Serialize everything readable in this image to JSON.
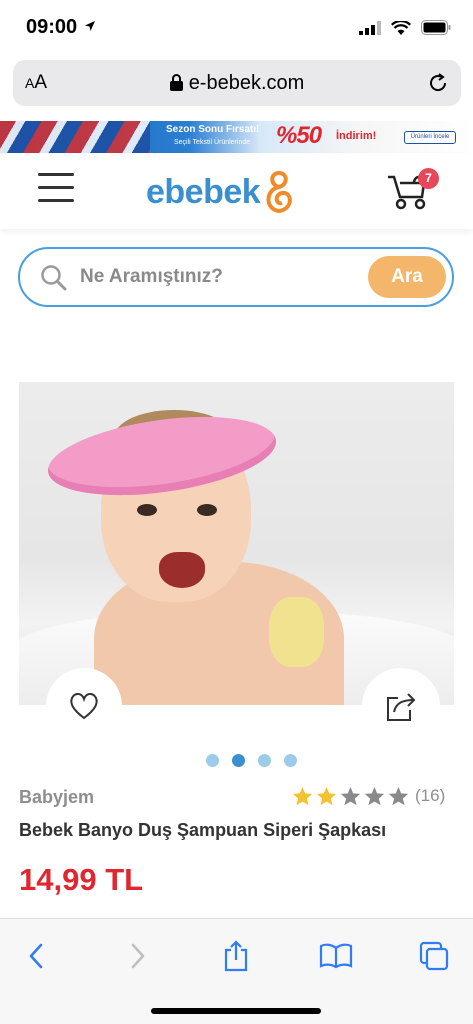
{
  "status_bar": {
    "time": "09:00"
  },
  "url_bar": {
    "aa_small": "A",
    "aa_large": "A",
    "host": "e-bebek.com"
  },
  "banner": {
    "title": "Sezon Sonu Fırsatı!",
    "subtitle": "Seçili Tekstil Ürünlerinde",
    "percent": "%50",
    "discount": "İndirim!",
    "cta": "Ürünleri İncele"
  },
  "header": {
    "logo_text": "ebebek",
    "cart_count": "7"
  },
  "search": {
    "placeholder": "Ne Aramıştınız?",
    "button_label": "Ara"
  },
  "gallery": {
    "slide_count": 4,
    "active_index": 1
  },
  "product": {
    "brand": "Babyjem",
    "title": "Bebek Banyo Duş Şampuan Siperi Şapkası",
    "price": "14,99 TL",
    "rating": {
      "stars_filled": 2,
      "stars_total": 5,
      "review_count": "(16)"
    }
  },
  "colors": {
    "brand_blue": "#3a8fd0",
    "brand_orange": "#f4b66a",
    "price_red": "#e0262f",
    "badge_red": "#e8465a",
    "star_gold": "#f2c230",
    "star_gray": "#8a8a8a",
    "ios_blue": "#2f7cf6"
  },
  "icons": {
    "location": "location-arrow-icon",
    "lock": "lock-icon",
    "reload": "reload-icon",
    "menu": "hamburger-menu-icon",
    "cart": "stroller-cart-icon",
    "search": "search-icon",
    "favorite": "heart-icon",
    "share": "share-icon",
    "back": "chevron-left-icon",
    "forward": "chevron-right-icon",
    "ios_share": "share-upload-icon",
    "bookmarks": "book-icon",
    "tabs": "tabs-icon"
  }
}
